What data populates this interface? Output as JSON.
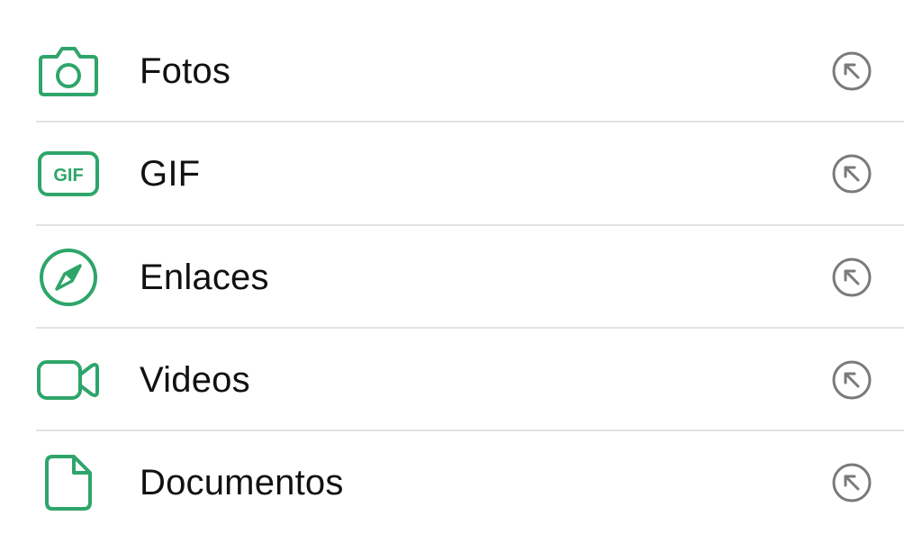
{
  "colors": {
    "accent": "#2ea56a",
    "text": "#111111",
    "secondary_icon": "#7a7a7a",
    "divider": "#e3e3e3"
  },
  "items": [
    {
      "label": "Fotos",
      "icon": "camera-icon",
      "trailing_icon": "open-arrow-icon"
    },
    {
      "label": "GIF",
      "icon": "gif-icon",
      "icon_text": "GIF",
      "trailing_icon": "open-arrow-icon"
    },
    {
      "label": "Enlaces",
      "icon": "compass-icon",
      "trailing_icon": "open-arrow-icon"
    },
    {
      "label": "Videos",
      "icon": "video-camera-icon",
      "trailing_icon": "open-arrow-icon"
    },
    {
      "label": "Documentos",
      "icon": "document-icon",
      "trailing_icon": "open-arrow-icon"
    }
  ]
}
